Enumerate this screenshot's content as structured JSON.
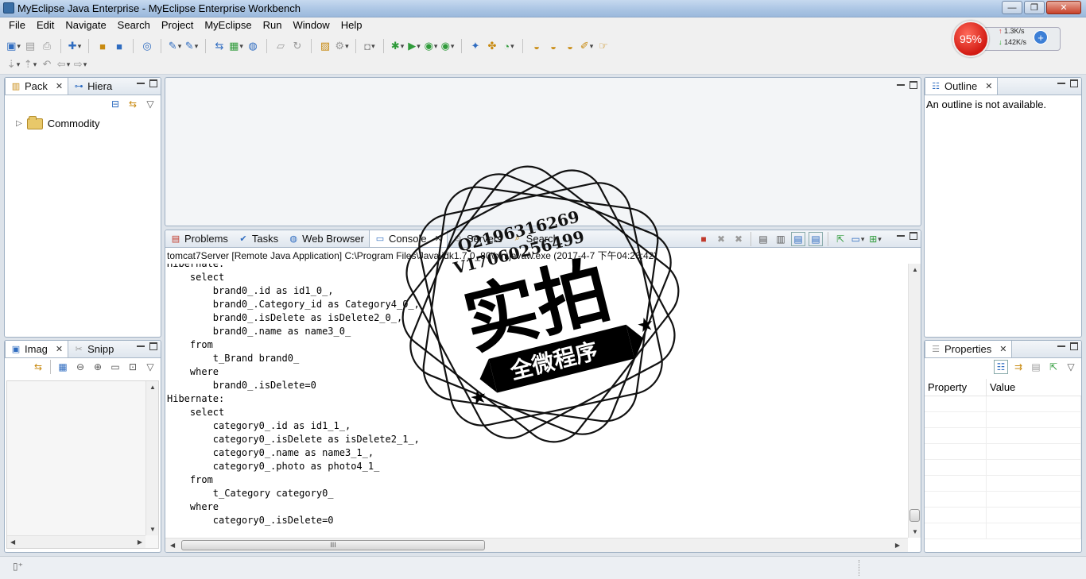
{
  "window": {
    "title": "MyEclipse Java Enterprise - MyEclipse Enterprise Workbench",
    "minimize": "—",
    "restore": "❐",
    "close": "✕"
  },
  "menu": [
    "File",
    "Edit",
    "Navigate",
    "Search",
    "Project",
    "MyEclipse",
    "Run",
    "Window",
    "Help"
  ],
  "net_widget": {
    "percent": "95%",
    "upload": "1.3K/s",
    "download": "142K/s"
  },
  "left_top_view": {
    "tabs": [
      "Pack",
      "Hiera"
    ],
    "tree_item": "Commodity"
  },
  "left_bottom_view": {
    "tabs": [
      "Imag",
      "Snipp"
    ]
  },
  "console_view": {
    "tabs": [
      "Problems",
      "Tasks",
      "Web Browser",
      "Console",
      "Servers",
      "Search"
    ],
    "active_tab": "Console",
    "header": "tomcat7Server [Remote Java Application] C:\\Program Files\\Java\\jdk1.7.0_80\\bin\\javaw.exe (2017-4-7 下午04:26:42)",
    "lines": [
      "Hibernate:",
      "    select",
      "        brand0_.id as id1_0_,",
      "        brand0_.Category_id as Category4_0_,",
      "        brand0_.isDelete as isDelete2_0_,",
      "        brand0_.name as name3_0_",
      "    from",
      "        t_Brand brand0_",
      "    where",
      "        brand0_.isDelete=0",
      "Hibernate:",
      "    select",
      "        category0_.id as id1_1_,",
      "        category0_.isDelete as isDelete2_1_,",
      "        category0_.name as name3_1_,",
      "        category0_.photo as photo4_1_",
      "    from",
      "        t_Category category0_",
      "    where",
      "        category0_.isDelete=0"
    ],
    "hscroll_grip": "III"
  },
  "outline_view": {
    "tab": "Outline",
    "message": "An outline is not available."
  },
  "properties_view": {
    "tab": "Properties",
    "columns": [
      "Property",
      "Value"
    ]
  },
  "watermark": {
    "contact_q": "Q2196316269",
    "contact_v": "V17060256499",
    "big_text": "实拍",
    "ribbon_text": "全微程序"
  }
}
